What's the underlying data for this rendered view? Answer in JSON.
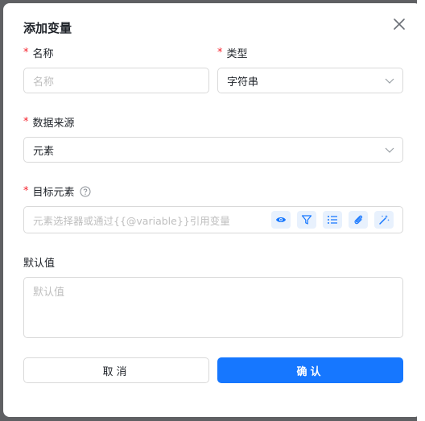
{
  "dialog": {
    "title": "添加变量",
    "required_mark": "*"
  },
  "fields": {
    "name": {
      "label": "名称",
      "placeholder": "名称",
      "value": ""
    },
    "type": {
      "label": "类型",
      "value": "字符串"
    },
    "source": {
      "label": "数据来源",
      "value": "元素"
    },
    "target": {
      "label": "目标元素",
      "placeholder": "元素选择器或通过{{@variable}}引用变量",
      "tools": [
        "eye-icon",
        "filter-icon",
        "list-icon",
        "paperclip-icon",
        "magic-wand-icon"
      ]
    },
    "default": {
      "label": "默认值",
      "placeholder": "默认值"
    }
  },
  "buttons": {
    "cancel": "取消",
    "confirm": "确认"
  },
  "colors": {
    "primary": "#1677ff",
    "required": "#f5222d",
    "tool_bg": "#e8f1fd"
  }
}
